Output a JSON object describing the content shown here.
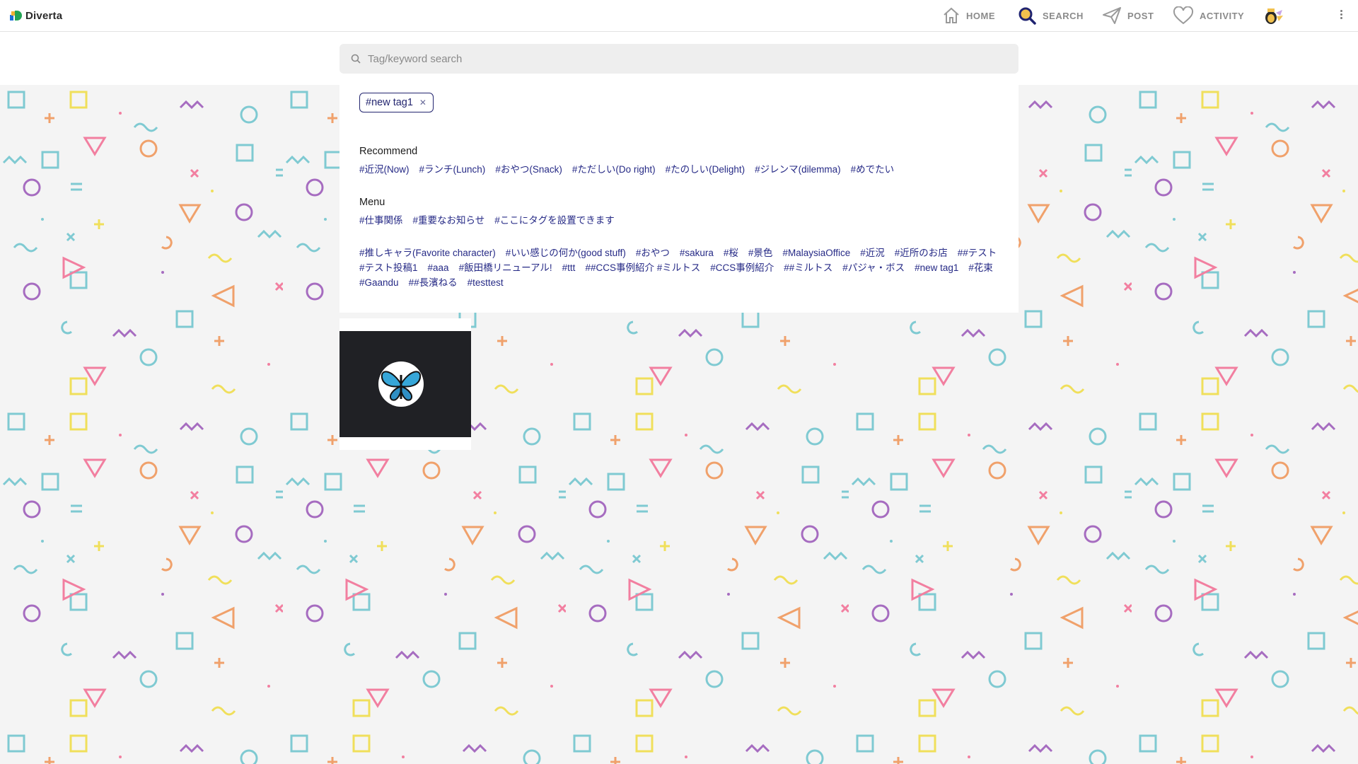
{
  "brand": {
    "name": "Diverta"
  },
  "nav": {
    "home": "HOME",
    "search": "SEARCH",
    "post": "POST",
    "activity": "ACTIVITY"
  },
  "icons": {
    "home": "home-icon",
    "search": "search-icon",
    "post": "send-icon",
    "activity": "heart-icon",
    "menu": "kebab-menu-icon"
  },
  "colors": {
    "accent": "#23256f",
    "tag_link": "#262a86",
    "search_active": "#f2c14e",
    "nav_text": "#8b8b8b"
  },
  "search": {
    "placeholder": "Tag/keyword search",
    "value": ""
  },
  "selected_tags": [
    "#new tag1"
  ],
  "recommend": {
    "title": "Recommend",
    "tags": [
      "#近況(Now)",
      "#ランチ(Lunch)",
      "#おやつ(Snack)",
      "#ただしい(Do right)",
      "#たのしい(Delight)",
      "#ジレンマ(dilemma)",
      "#めでたい"
    ]
  },
  "menu": {
    "title": "Menu",
    "tags": [
      "#仕事関係",
      "#重要なお知らせ",
      "#ここにタグを設置できます"
    ]
  },
  "other_tags": [
    "#推しキャラ(Favorite character)",
    "#いい感じの何か(good stuff)",
    "#おやつ",
    "#sakura",
    "#桜",
    "#景色",
    "#MalaysiaOffice",
    "#近況",
    "#近所のお店",
    "##テスト",
    "#テスト投稿1",
    "#aaa",
    "#飯田橋リニューアル!",
    "#ttt",
    "##CCS事例紹介 #ミルトス",
    "#CCS事例紹介",
    "##ミルトス",
    "#パジャ・ボス",
    "#new tag1",
    "#花束",
    "#Gaandu",
    "##長濱ねる",
    "#testtest"
  ],
  "result_card": {
    "image": "butterfly-logo"
  }
}
